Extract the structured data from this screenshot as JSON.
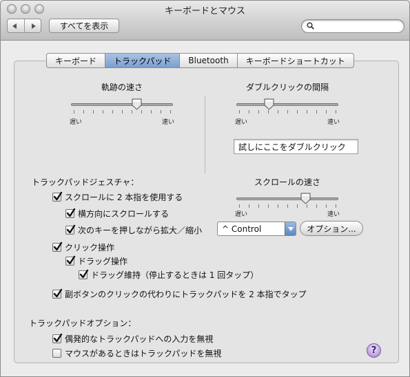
{
  "window": {
    "title": "キーボードとマウス"
  },
  "toolbar": {
    "back_icon": "back-arrow-icon",
    "forward_icon": "forward-arrow-icon",
    "show_all_label": "すべてを表示",
    "search_value": ""
  },
  "tabs": [
    {
      "label": "キーボード",
      "selected": false
    },
    {
      "label": "トラックパッド",
      "selected": true
    },
    {
      "label": "Bluetooth",
      "selected": false
    },
    {
      "label": "キーボードショートカット",
      "selected": false
    }
  ],
  "tracking": {
    "title": "軌跡の速さ",
    "min": "遅い",
    "max": "速い",
    "value": 0.66
  },
  "doubleclick": {
    "title": "ダブルクリックの間隔",
    "min": "遅い",
    "max": "速い",
    "value": 0.3,
    "test_field": "試しにここをダブルクリック"
  },
  "scroll": {
    "title": "スクロールの速さ",
    "min": "遅い",
    "max": "速い",
    "value": 0.7
  },
  "gestures": {
    "heading": "トラックパッドジェスチャ：",
    "two_finger_scroll": {
      "label": "スクロールに 2 本指を使用する",
      "checked": true
    },
    "horizontal_scroll": {
      "label": "横方向にスクロールする",
      "checked": true
    },
    "zoom_key": {
      "label": "次のキーを押しながら拡大／縮小",
      "checked": true
    },
    "zoom_key_value": "^ Control",
    "options_button": "オプション...",
    "click": {
      "label": "クリック操作",
      "checked": true
    },
    "drag": {
      "label": "ドラッグ操作",
      "checked": true
    },
    "drag_lock": {
      "label": "ドラッグ維持（停止するときは 1 回タップ）",
      "checked": true
    },
    "secondary": {
      "label": "副ボタンのクリックの代わりにトラックパッドを 2 本指でタップ",
      "checked": true
    }
  },
  "options": {
    "heading": "トラックパッドオプション：",
    "ignore_accidental": {
      "label": "偶発的なトラックパッドへの入力を無視",
      "checked": true
    },
    "ignore_with_mouse": {
      "label": "マウスがあるときはトラックパッドを無視",
      "checked": false
    }
  },
  "help": {
    "label": "?"
  }
}
